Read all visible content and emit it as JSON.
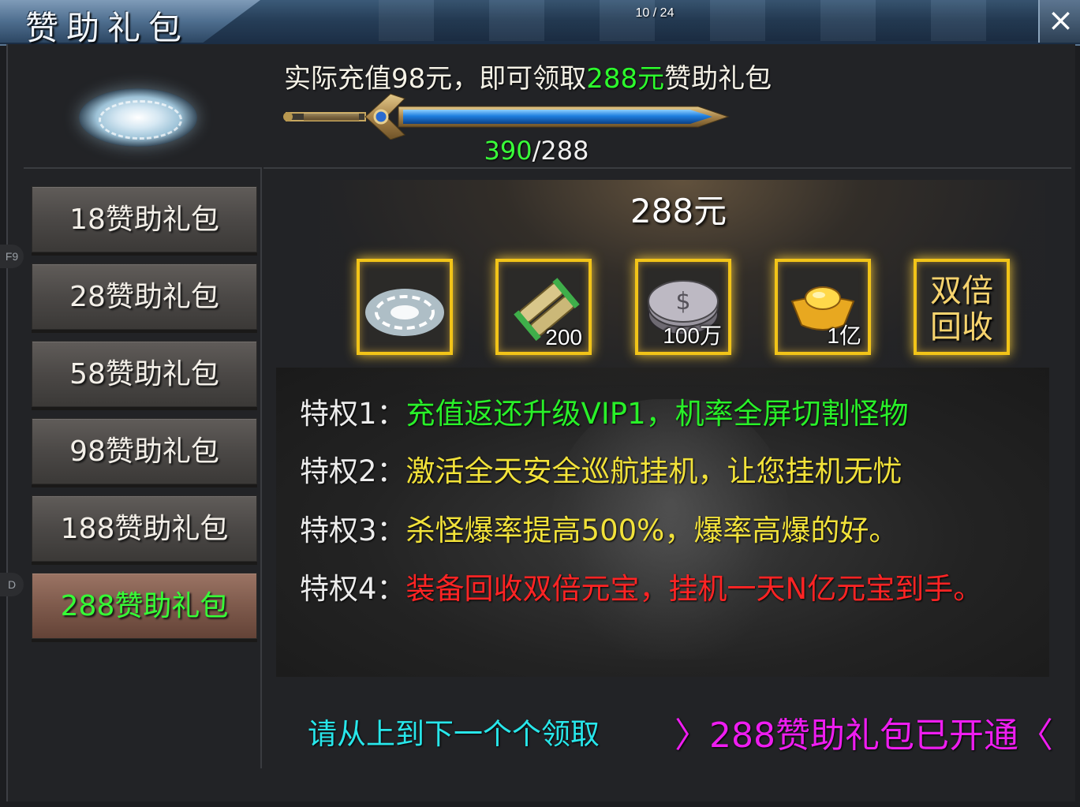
{
  "window": {
    "title": "赞助礼包",
    "page_counter": "10 / 24",
    "close_icon": "×"
  },
  "hotkeys": [
    "F9",
    "D"
  ],
  "header": {
    "requirement_prefix": "实际充值98元，即可领取",
    "requirement_amount": "288元",
    "requirement_suffix": "赞助礼包",
    "progress": {
      "current": "390",
      "separator": "/",
      "target": "288"
    }
  },
  "tabs": [
    {
      "label": "18赞助礼包",
      "active": false
    },
    {
      "label": "28赞助礼包",
      "active": false
    },
    {
      "label": "58赞助礼包",
      "active": false
    },
    {
      "label": "98赞助礼包",
      "active": false
    },
    {
      "label": "188赞助礼包",
      "active": false
    },
    {
      "label": "288赞助礼包",
      "active": true
    }
  ],
  "package": {
    "price_title": "288元",
    "rewards": [
      {
        "icon": "vortex-icon",
        "count": ""
      },
      {
        "icon": "scroll-icon",
        "count": "200"
      },
      {
        "icon": "silver-coin-icon",
        "count": "100万"
      },
      {
        "icon": "gold-ingot-icon",
        "count": "1亿"
      },
      {
        "icon": "double-recycle-icon",
        "text_line1": "双倍",
        "text_line2": "回收",
        "count": ""
      }
    ]
  },
  "privileges": [
    {
      "label": "特权1：",
      "text": "充值返还升级VIP1，机率全屏切割怪物",
      "color": "#29f029"
    },
    {
      "label": "特权2：",
      "text": "激活全天安全巡航挂机，让您挂机无忧",
      "color": "#f2e23a"
    },
    {
      "label": "特权3：",
      "text": "杀怪爆率提高500%，爆率高爆的好。",
      "color": "#f2e23a"
    },
    {
      "label": "特权4：",
      "text": "装备回收双倍元宝，挂机一天N亿元宝到手。",
      "color": "#ff2424"
    }
  ],
  "footer": {
    "note": "请从上到下一个个领取",
    "status": "〉288赞助礼包已开通〈"
  },
  "colors": {
    "highlight_green": "#2dff2d",
    "slot_border": "#f2c418",
    "footer_note": "#28e6ea",
    "footer_status": "#ee1df0"
  }
}
